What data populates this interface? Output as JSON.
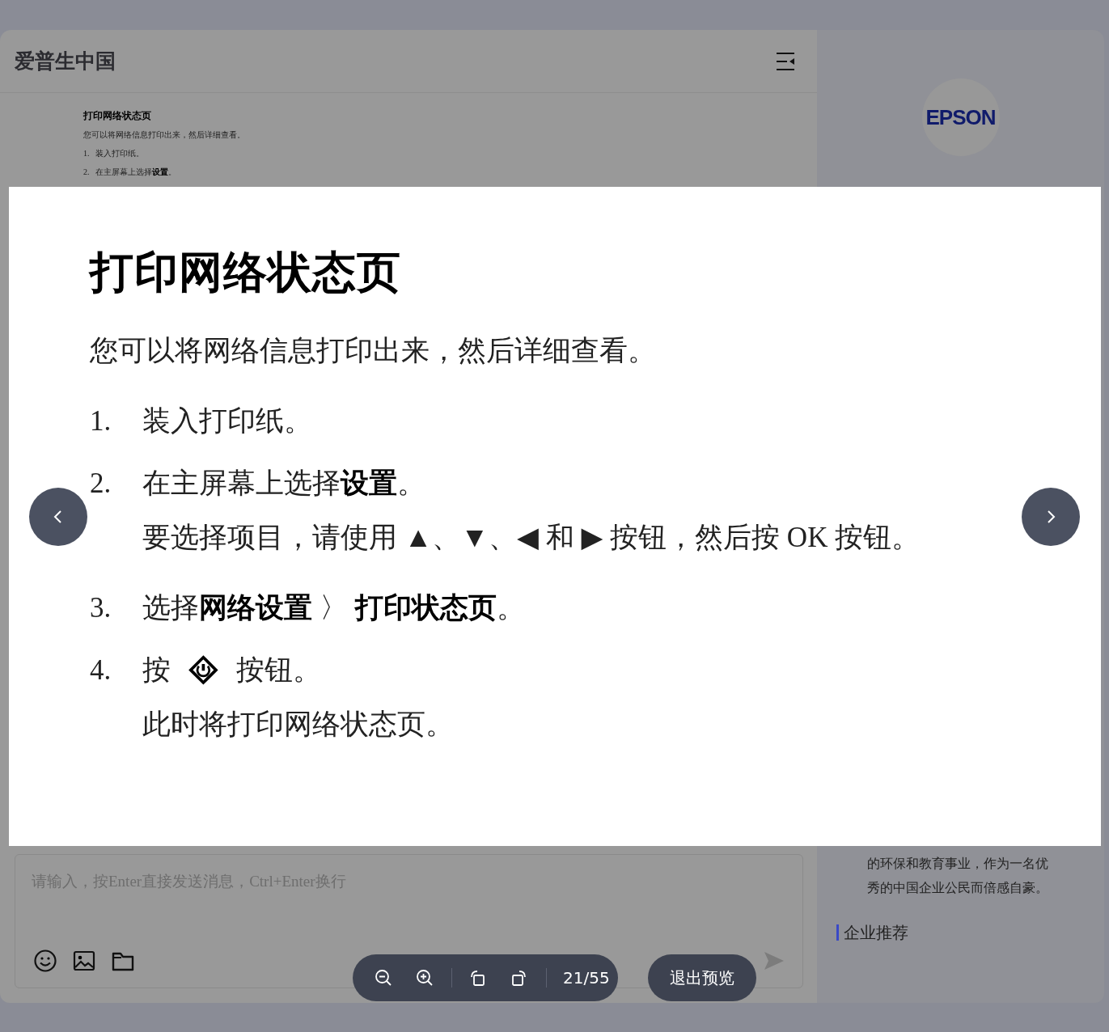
{
  "chat": {
    "title": "爱普生中国",
    "message_document": {
      "title": "打印网络状态页",
      "lines": [
        {
          "kind": "plain",
          "text": "您可以将网络信息打印出来，然后详细查看。"
        },
        {
          "kind": "step",
          "number": "1.",
          "text": "装入打印纸。"
        },
        {
          "kind": "step",
          "number": "2.",
          "text": "在主屏幕上选择**设置**。"
        }
      ]
    },
    "input": {
      "placeholder": "请输入，按Enter直接发送消息，Ctrl+Enter换行"
    }
  },
  "profile": {
    "logo": "EPSON",
    "description_lines": [
      "的环保和教育事业，作为一名优",
      "秀的中国企业公民而倍感自豪。"
    ],
    "section_title": "企业推荐"
  },
  "preview": {
    "document": {
      "title": "打印网络状态页",
      "lines": [
        {
          "kind": "plain",
          "text": "您可以将网络信息打印出来，然后详细查看。"
        },
        {
          "kind": "step",
          "number": "1.",
          "text": "装入打印纸。"
        },
        {
          "kind": "step",
          "number": "2.",
          "text": "在主屏幕上选择**设置**。"
        },
        {
          "kind": "indent",
          "text": "要选择项目，请使用 ▲、▼、◀ 和 ▶ 按钮，然后按 OK 按钮。"
        },
        {
          "kind": "step",
          "number": "3.",
          "text": "选择**网络设置** 〉 **打印状态页**。"
        },
        {
          "kind": "step-icon",
          "number": "4.",
          "before": "按",
          "after": "按钮。"
        },
        {
          "kind": "indent",
          "text": "此时将打印网络状态页。"
        }
      ]
    },
    "page_counter": "21/55",
    "exit_label": "退出预览"
  }
}
